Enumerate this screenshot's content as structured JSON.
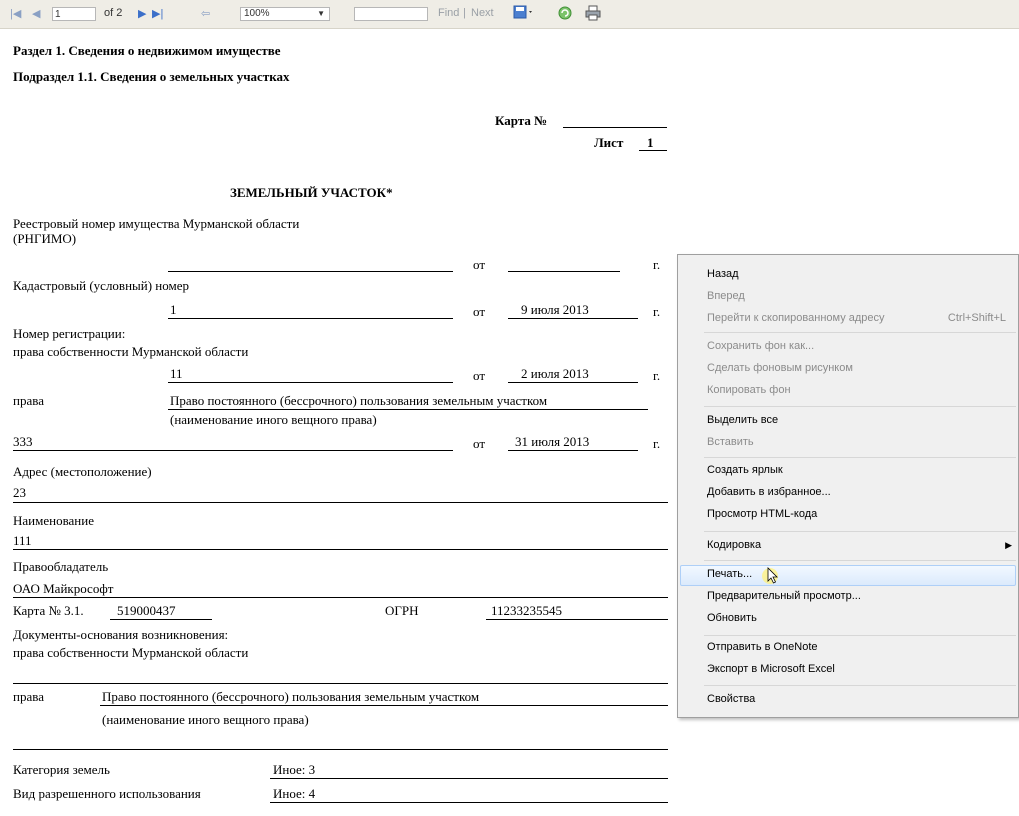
{
  "toolbar": {
    "page_current": "1",
    "page_of": "of 2",
    "zoom": "100%",
    "find_value": "",
    "find_label": "Find",
    "separator": "|",
    "next_label": "Next"
  },
  "doc": {
    "section": "Раздел 1. Сведения о недвижимом имуществе",
    "subsection": "Подраздел 1.1. Сведения о земельных участках",
    "card_label": "Карта №",
    "sheet_label": "Лист",
    "sheet_no": "1",
    "title": "ЗЕМЕЛЬНЫЙ УЧАСТОК*",
    "reg_num_label_1": "Реестровый номер имущества Мурманской области",
    "reg_num_label_2": "(РНГИМО)",
    "ot": "от",
    "g": "г.",
    "cadastral_label": "Кадастровый (условный) номер",
    "cadastral_value": "1",
    "cadastral_date": "9 июля 2013",
    "reg_label_1": "Номер регистрации:",
    "reg_label_2": "права собственности Мурманской области",
    "reg_value": "11",
    "reg_date": "2 июля 2013",
    "rights_label": "права",
    "rights_value": "Право постоянного (бессрочного) пользования земельным участком",
    "rights_hint": "(наименование иного вещного права)",
    "rights_number": "333",
    "rights_date": "31 июля 2013",
    "address_label": "Адрес (местоположение)",
    "address_value": "23",
    "name_label": "Наименование",
    "name_value": "111",
    "holder_label": "Правообладатель",
    "holder_value": "ОАО Майкрософт",
    "card31_label": "Карта № 3.1.",
    "card31_value": "519000437",
    "ogrn_label": "ОГРН",
    "ogrn_value": "11233235545",
    "docs_label_1": "Документы-основания возникновения:",
    "docs_label_2": "права собственности Мурманской области",
    "rights2_label": "права",
    "rights2_value": "Право постоянного (бессрочного) пользования земельным участком",
    "rights2_hint": "(наименование иного вещного права)",
    "category_label": "Категория земель",
    "category_value": "Иное: 3",
    "usage_label": "Вид разрешенного использования",
    "usage_value": "Иное: 4"
  },
  "menu": {
    "items": [
      {
        "label": "Назад",
        "enabled": true
      },
      {
        "label": "Вперед",
        "enabled": false
      },
      {
        "label": "Перейти к скопированному адресу",
        "shortcut": "Ctrl+Shift+L",
        "enabled": false
      },
      {
        "label": "Сохранить фон как...",
        "enabled": false
      },
      {
        "label": "Сделать фоновым рисунком",
        "enabled": false
      },
      {
        "label": "Копировать фон",
        "enabled": false
      },
      {
        "label": "Выделить все",
        "enabled": true
      },
      {
        "label": "Вставить",
        "enabled": false
      },
      {
        "label": "Создать ярлык",
        "enabled": true
      },
      {
        "label": "Добавить в избранное...",
        "enabled": true
      },
      {
        "label": "Просмотр HTML-кода",
        "enabled": true
      },
      {
        "label": "Кодировка",
        "enabled": true
      },
      {
        "label": "Печать...",
        "enabled": true
      },
      {
        "label": "Предварительный просмотр...",
        "enabled": true
      },
      {
        "label": "Обновить",
        "enabled": true
      },
      {
        "label": "Отправить в OneNote",
        "enabled": true
      },
      {
        "label": "Экспорт в Microsoft Excel",
        "enabled": true
      },
      {
        "label": "Свойства",
        "enabled": true
      }
    ],
    "highlighted": "Печать..."
  },
  "icons": [
    "first-page-icon",
    "prev-page-icon",
    "next-page-icon",
    "last-page-icon",
    "back-icon",
    "save-export-icon",
    "refresh-icon",
    "print-icon",
    "submenu-arrow-icon",
    "cursor-icon"
  ]
}
